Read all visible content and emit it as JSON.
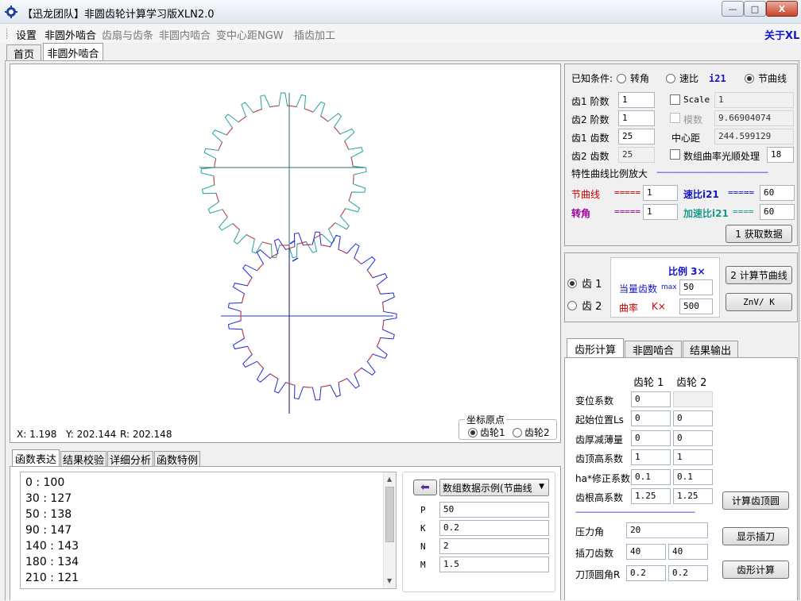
{
  "window": {
    "title": "【迅龙团队】非圆齿轮计算学习版XLN2.0",
    "controls": {
      "minimize": "—",
      "maximize": "□",
      "close": "X"
    }
  },
  "menu": {
    "items": [
      "设置",
      "非圆外啮合",
      "齿扇与齿条",
      "非圆内啮合",
      "变中心距NGW",
      "插齿加工"
    ],
    "about": "关于XL"
  },
  "top_tabs": [
    "首页",
    "非圆外啮合"
  ],
  "canvas": {
    "coords": {
      "x": "X: 1.198",
      "y": "Y: 202.144",
      "r": "R: 202.148"
    },
    "origin_group": {
      "label": "坐标原点",
      "opt1": "齿轮1",
      "opt2": "齿轮2"
    },
    "colors": {
      "gear1": "#21a39a",
      "gear1_root": "#d23c3c",
      "gear2": "#1f2bd8",
      "axis": "#0f1070"
    }
  },
  "known": {
    "label": "已知条件:",
    "opt_angle": "转角",
    "opt_ratio": "速比",
    "ratio_sym": "i21",
    "opt_pitch": "节曲线"
  },
  "params": {
    "g1_order_label": "齿1 阶数",
    "g1_order": "1",
    "g2_order_label": "齿2 阶数",
    "g2_order": "1",
    "g1_teeth_label": "齿1 齿数",
    "g1_teeth": "25",
    "g2_teeth_label": "齿2 齿数",
    "g2_teeth": "25",
    "scale_label": "Scale",
    "scale": "1",
    "module_label": "模数",
    "module": "9.66904074",
    "center_label": "中心距",
    "center": "244.599129",
    "smooth_label": "数组曲率光顺处理",
    "smooth": "18"
  },
  "magnify": {
    "title": "特性曲线比例放大",
    "dashes": "——————————————",
    "pitch_label": "节曲线",
    "pitch_eq": "=====",
    "pitch_val": "1",
    "angle_label": "转角",
    "angle_eq": "=====",
    "angle_val": "1",
    "speed_label": "速比i21",
    "speed_eq": "=====",
    "speed_val": "60",
    "accel_label": "加速比i21",
    "accel_eq": "====",
    "accel_val": "60",
    "get_btn": "1 获取数据"
  },
  "ratio_box": {
    "gear1": "齿 1",
    "gear2": "齿 2",
    "title": "比例 3×",
    "equiv_label": "当量齿数",
    "equiv_max": "max",
    "equiv_val": "50",
    "curv_label": "曲率",
    "curv_k": "K×",
    "curv_val": "500",
    "calc_btn": "2 计算节曲线",
    "znv_btn": "ZnV/ K"
  },
  "bottom_tabs": [
    "齿形计算",
    "非圆啮合",
    "结果输出"
  ],
  "tooth": {
    "head1": "齿轮 1",
    "head2": "齿轮 2",
    "rows": [
      {
        "label": "变位系数",
        "v1": "0",
        "v2": ""
      },
      {
        "label": "起始位置Ls",
        "v1": "0",
        "v2": "0"
      },
      {
        "label": "齿厚减薄量",
        "v1": "0",
        "v2": "0"
      },
      {
        "label": "齿顶高系数",
        "v1": "1",
        "v2": "1"
      },
      {
        "label": "ha*修正系数",
        "v1": "0.1",
        "v2": "0.1"
      },
      {
        "label": "齿根高系数",
        "v1": "1.25",
        "v2": "1.25"
      }
    ],
    "divider": "———————————————",
    "pressure_label": "压力角",
    "pressure": "20",
    "cutter_label": "插刀齿数",
    "cutter1": "40",
    "cutter2": "40",
    "tip_label": "刀顶圆角R",
    "tip1": "0.2",
    "tip2": "0.2",
    "btn_tip_circle": "计算齿顶圆",
    "btn_show_cutter": "显示插刀",
    "btn_tooth_calc": "齿形计算"
  },
  "func_tabs": [
    "函数表达",
    "结果校验",
    "详细分析",
    "函数特例"
  ],
  "func_list": [
    "0 : 100",
    "30 : 127",
    "50 : 138",
    "90 : 147",
    "140 : 143",
    "180 : 134",
    "210 : 121"
  ],
  "example": {
    "arrow": "⬅",
    "select": "数组数据示例(节曲线",
    "p_label": "P",
    "p": "50",
    "k_label": "K",
    "k": "0.2",
    "n_label": "N",
    "n": "2",
    "m_label": "M",
    "m": "1.5"
  }
}
